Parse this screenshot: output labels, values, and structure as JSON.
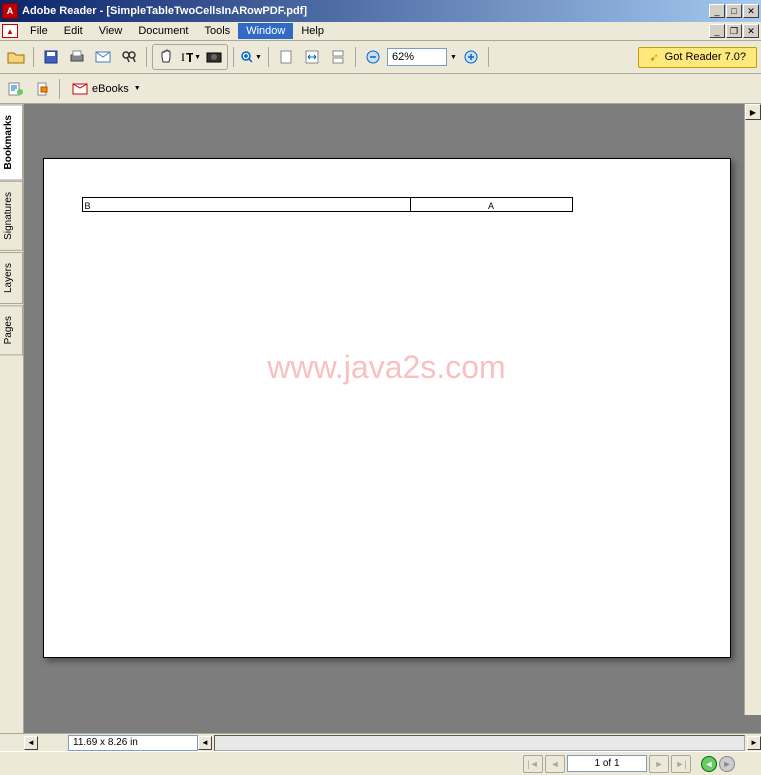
{
  "window": {
    "app_name": "Adobe Reader",
    "doc_name": "[SimpleTableTwoCellsInARowPDF.pdf]"
  },
  "menu": {
    "file": "File",
    "edit": "Edit",
    "view": "View",
    "document": "Document",
    "tools": "Tools",
    "window": "Window",
    "help": "Help"
  },
  "toolbar": {
    "zoom_value": "62%",
    "promo": "Got Reader 7.0?",
    "ebooks": "eBooks"
  },
  "sidetabs": {
    "bookmarks": "Bookmarks",
    "signatures": "Signatures",
    "layers": "Layers",
    "pages": "Pages"
  },
  "document": {
    "watermark": "www.java2s.com",
    "table": {
      "cell_b": "B",
      "cell_a": "A"
    },
    "dimensions": "11.69 x 8.26 in"
  },
  "status": {
    "page_indicator": "1 of 1"
  }
}
